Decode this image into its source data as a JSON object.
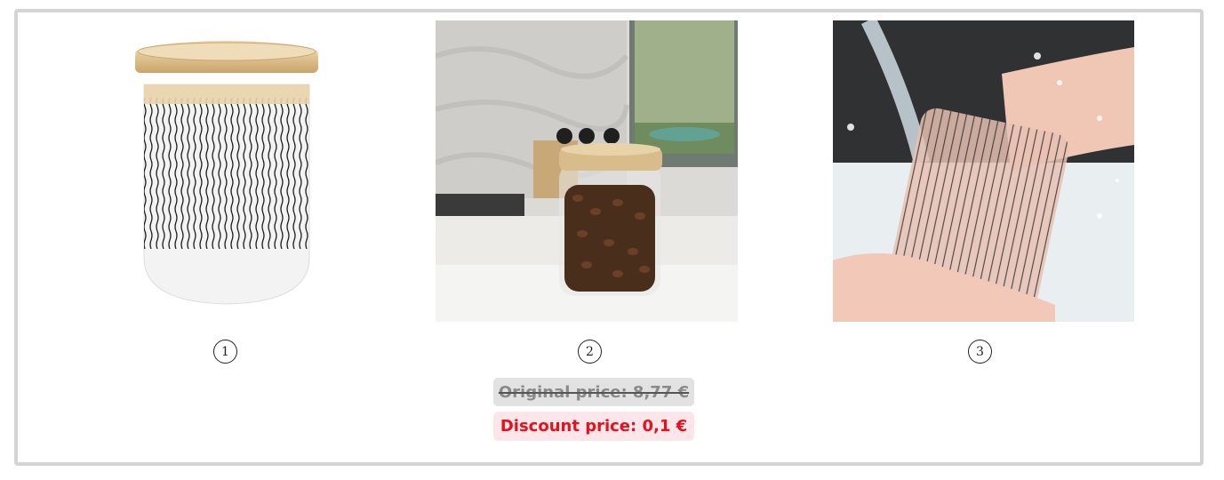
{
  "products": [
    {
      "badge": "1",
      "image": "striped-glass-jar-bamboo-lid"
    },
    {
      "badge": "2",
      "image": "jar-with-coffee-beans-on-kitchen-counter"
    },
    {
      "badge": "3",
      "image": "jar-being-rinsed-under-water"
    }
  ],
  "pricing": {
    "original_label": "Original price: 8,77 €",
    "discount_label": "Discount price: 0,1 €"
  },
  "colors": {
    "frame_border": "#d4d4d4",
    "original_bg": "#e2e2e2",
    "original_text": "#8a8a8a",
    "discount_bg": "#fde6ea",
    "discount_text": "#e8101a"
  }
}
